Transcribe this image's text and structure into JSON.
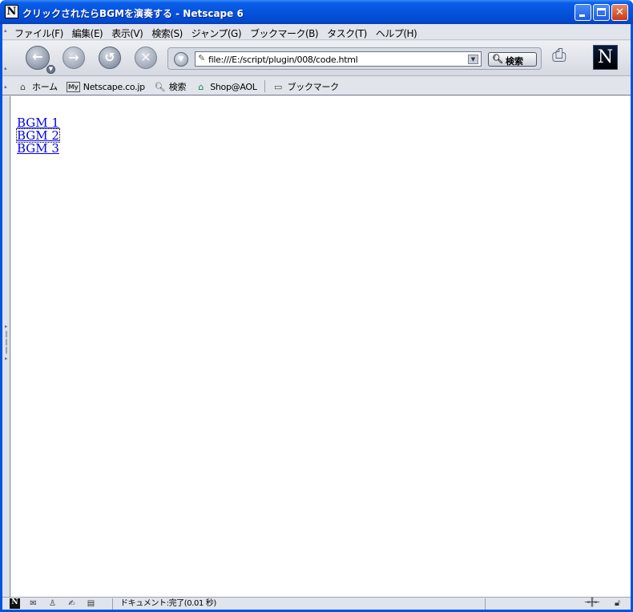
{
  "window": {
    "title": "クリックされたらBGMを演奏する - Netscape 6",
    "app_icon": "N"
  },
  "menubar": {
    "items": [
      "ファイル(F)",
      "編集(E)",
      "表示(V)",
      "検索(S)",
      "ジャンプ(G)",
      "ブックマーク(B)",
      "タスク(T)",
      "ヘルプ(H)"
    ]
  },
  "navbar": {
    "url": "file:///E:/script/plugin/008/code.html",
    "search_label": "検索",
    "logo": "N"
  },
  "personal_toolbar": {
    "items": [
      {
        "label": "ホーム",
        "icon": "home-icon"
      },
      {
        "label": "Netscape.co.jp",
        "icon": "my-netscape-icon",
        "icon_text": "My"
      },
      {
        "label": "検索",
        "icon": "search-icon"
      },
      {
        "label": "Shop@AOL",
        "icon": "shop-icon"
      },
      {
        "label": "ブックマーク",
        "icon": "folder-icon"
      }
    ]
  },
  "content": {
    "links": [
      "BGM 1",
      "BGM 2",
      "BGM 3"
    ],
    "link_color": "#0000ee"
  },
  "statusbar": {
    "status_text": "ドキュメント:完了(0.01 秒)"
  },
  "colors": {
    "titlebar": "#0553dc",
    "chrome": "#e1e4ea"
  }
}
